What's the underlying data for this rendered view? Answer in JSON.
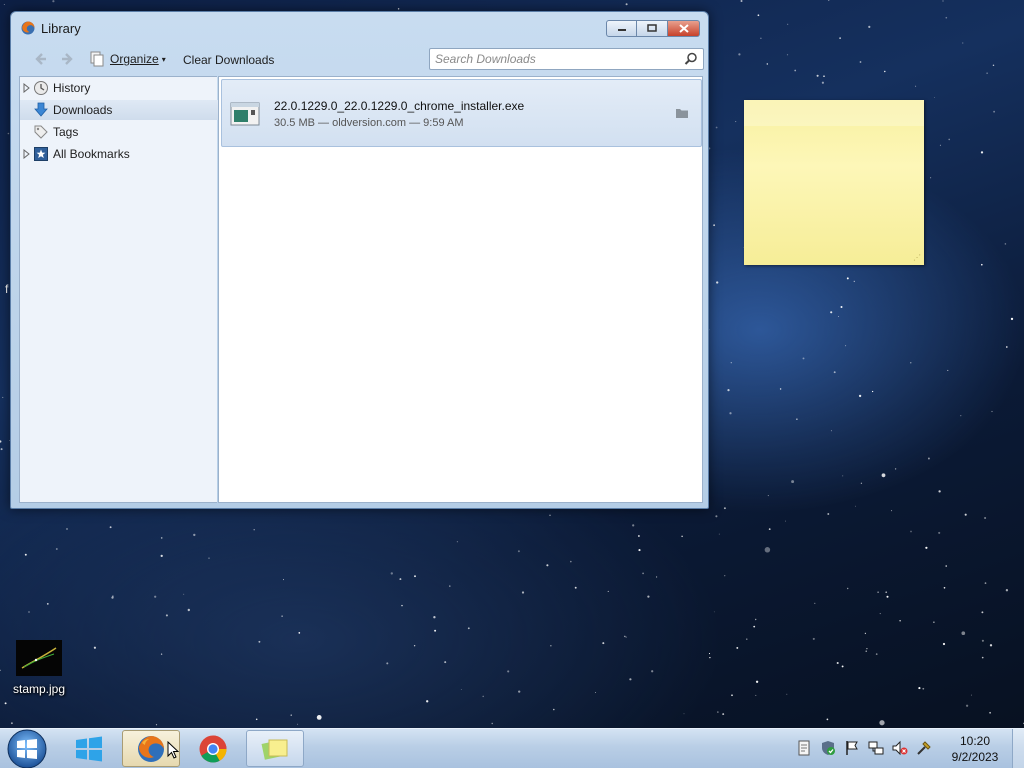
{
  "window": {
    "title": "Library",
    "minimize_icon": "minimize-icon",
    "maximize_icon": "maximize-icon",
    "close_icon": "close-icon"
  },
  "toolbar": {
    "back_icon": "back-arrow-icon",
    "forward_icon": "forward-arrow-icon",
    "organize_label": "Organize",
    "clear_downloads_label": "Clear Downloads",
    "search_placeholder": "Search Downloads",
    "search_value": ""
  },
  "sidebar": {
    "items": [
      {
        "label": "History",
        "icon": "clock-icon",
        "expandable": true,
        "selected": false
      },
      {
        "label": "Downloads",
        "icon": "download-arrow-icon",
        "expandable": false,
        "selected": true
      },
      {
        "label": "Tags",
        "icon": "tag-icon",
        "expandable": false,
        "selected": false
      },
      {
        "label": "All Bookmarks",
        "icon": "bookmarks-star-icon",
        "expandable": true,
        "selected": false
      }
    ]
  },
  "downloads": [
    {
      "filename": "22.0.1229.0_22.0.1229.0_chrome_installer.exe",
      "meta": "30.5 MB — oldversion.com — 9:59 AM",
      "icon": "exe-file-icon"
    }
  ],
  "desktop": {
    "edge_char": "f",
    "icons": [
      {
        "label": "stamp.jpg"
      }
    ]
  },
  "taskbar": {
    "start": "windows-start-orb",
    "pinned": [
      "windows-store-icon",
      "firefox-icon",
      "chrome-icon",
      "sticky-notes-icon"
    ],
    "tray": [
      "notes-icon",
      "security-shield-icon",
      "action-center-flag-icon",
      "network-icon",
      "volume-muted-icon",
      "tool-icon"
    ],
    "time": "10:20",
    "date": "9/2/2023"
  },
  "colors": {
    "sticky_note": "#fdf7b8",
    "selection": "#d2e0f1",
    "close_button": "#c7412a"
  }
}
